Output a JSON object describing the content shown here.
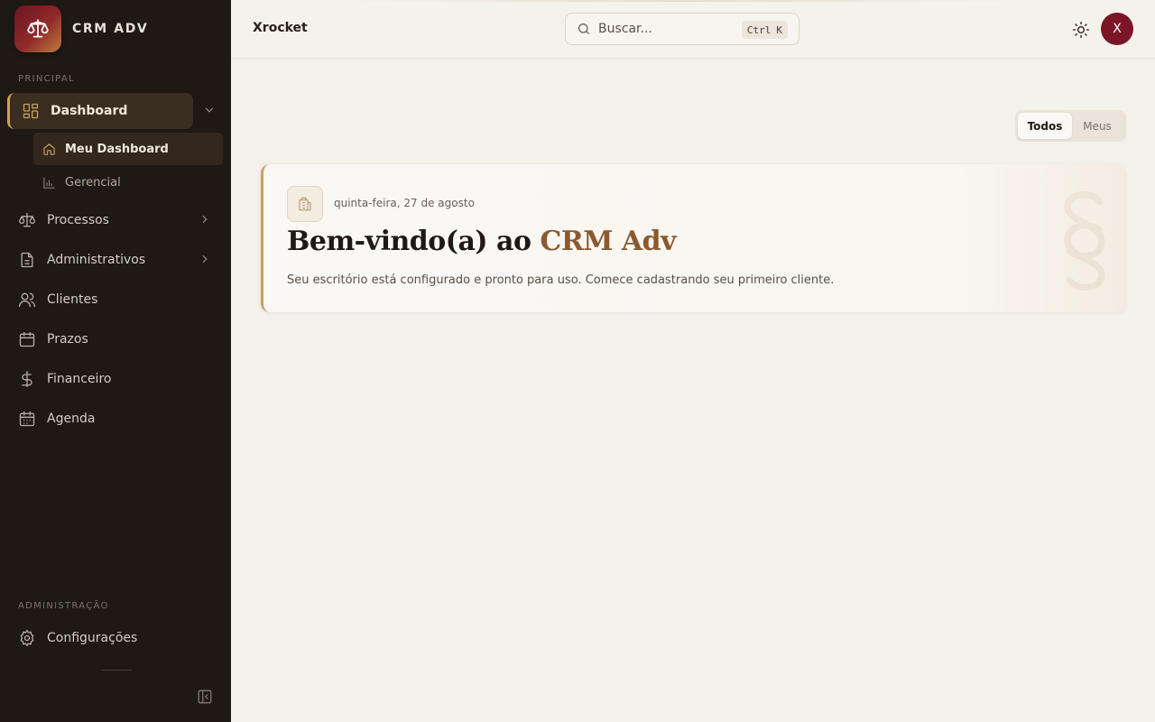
{
  "sidebar": {
    "brand": "CRM ADV",
    "section_principal": "PRINCIPAL",
    "section_admin": "ADMINISTRAÇÃO",
    "items": [
      {
        "label": "Dashboard"
      },
      {
        "label": "Processos"
      },
      {
        "label": "Administrativos"
      },
      {
        "label": "Clientes"
      },
      {
        "label": "Prazos"
      },
      {
        "label": "Financeiro"
      },
      {
        "label": "Agenda"
      }
    ],
    "dashboard_sub": [
      {
        "label": "Meu Dashboard"
      },
      {
        "label": "Gerencial"
      }
    ],
    "settings": "Configurações"
  },
  "topbar": {
    "workspace": "Xrocket",
    "search_placeholder": "Buscar...",
    "shortcut_key1": "Ctrl",
    "shortcut_key2": "K",
    "avatar_initial": "X"
  },
  "filter": {
    "all": "Todos",
    "mine": "Meus"
  },
  "welcome": {
    "date": "quinta-feira, 27 de agosto",
    "title_prefix": "Bem-vindo(a) ao",
    "title_accent": "CRM Adv",
    "subtitle": "Seu escritório está configurado e pronto para uso. Comece cadastrando seu primeiro cliente."
  },
  "colors": {
    "accent_gold": "#c8a15a",
    "brand_wine": "#7a1628",
    "sidebar_bg": "#1f1915"
  }
}
